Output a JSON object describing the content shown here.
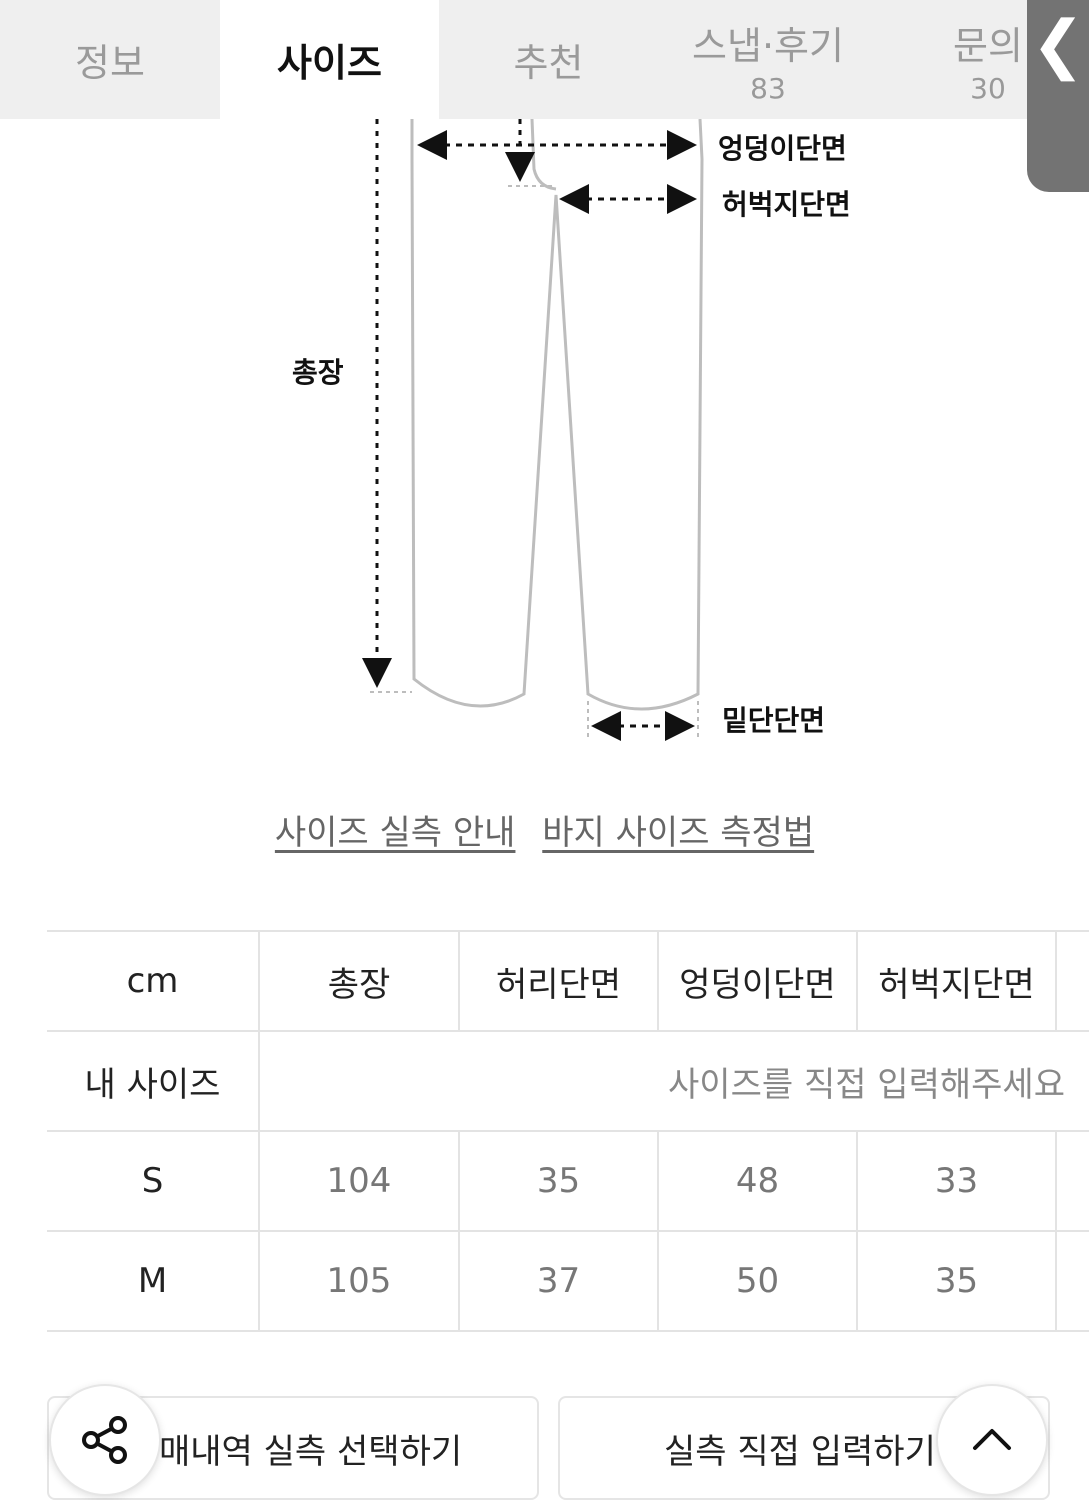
{
  "tabs": [
    {
      "label": "정보",
      "count": ""
    },
    {
      "label": "사이즈",
      "count": ""
    },
    {
      "label": "추천",
      "count": ""
    },
    {
      "label": "스냅·후기",
      "count": "83"
    },
    {
      "label": "문의",
      "count": "30"
    }
  ],
  "active_tab": "사이즈",
  "side_handle": {
    "glyph": "❮",
    "icon": "chevron-left-icon"
  },
  "diagram": {
    "labels": {
      "hip": "엉덩이단면",
      "thigh": "허벅지단면",
      "length": "총장",
      "hem": "밑단단면"
    }
  },
  "links": {
    "guide": "사이즈 실측 안내",
    "measure": "바지 사이즈 측정법"
  },
  "table": {
    "headers": [
      "cm",
      "총장",
      "허리단면",
      "엉덩이단면",
      "허벅지단면"
    ],
    "my_size": {
      "label": "내 사이즈",
      "placeholder": "사이즈를 직접 입력해주세요"
    },
    "rows": [
      {
        "size": "S",
        "values": [
          "104",
          "35",
          "48",
          "33"
        ]
      },
      {
        "size": "M",
        "values": [
          "105",
          "37",
          "50",
          "35"
        ]
      }
    ]
  },
  "buttons": {
    "purchase_select": "매내역 실측 선택하기",
    "manual_input": "실측 직접 입력하기"
  },
  "fabs": {
    "share_icon": "share-icon",
    "up_icon": "chevron-up-icon"
  },
  "colors": {
    "tab_bg": "#efefef",
    "handle_bg": "#737373",
    "border": "#e3e3e3"
  }
}
